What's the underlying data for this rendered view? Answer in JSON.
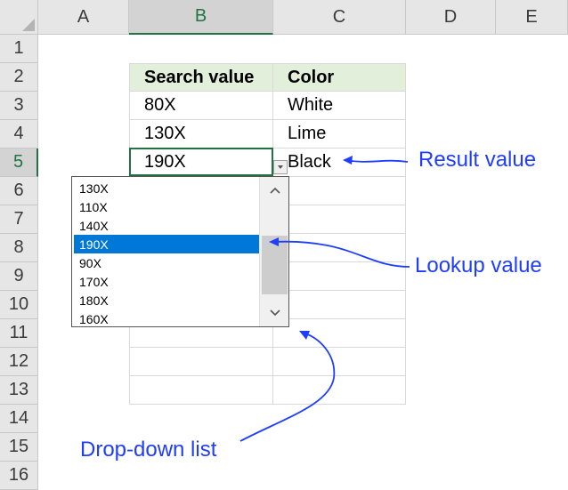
{
  "columns": [
    "A",
    "B",
    "C",
    "D",
    "E"
  ],
  "rows": [
    "1",
    "2",
    "3",
    "4",
    "5",
    "6",
    "7",
    "8",
    "9",
    "10",
    "11",
    "12",
    "13",
    "14",
    "15",
    "16"
  ],
  "table": {
    "headers": [
      "Search value",
      "Color"
    ],
    "data": [
      [
        "80X",
        "White"
      ],
      [
        "130X",
        "Lime"
      ],
      [
        "190X",
        "Black"
      ]
    ]
  },
  "dropdown": {
    "items": [
      "130X",
      "110X",
      "140X",
      "190X",
      "90X",
      "170X",
      "180X",
      "160X"
    ],
    "selected_index": 3,
    "scroll_position": 0.5
  },
  "annotations": {
    "result": "Result value",
    "lookup": "Lookup value",
    "dropdown": "Drop-down list"
  },
  "colors": {
    "header_fill": "#e2efda",
    "selection_green": "#217346",
    "list_highlight": "#0078d7",
    "annotation_blue": "#1f3dff"
  }
}
